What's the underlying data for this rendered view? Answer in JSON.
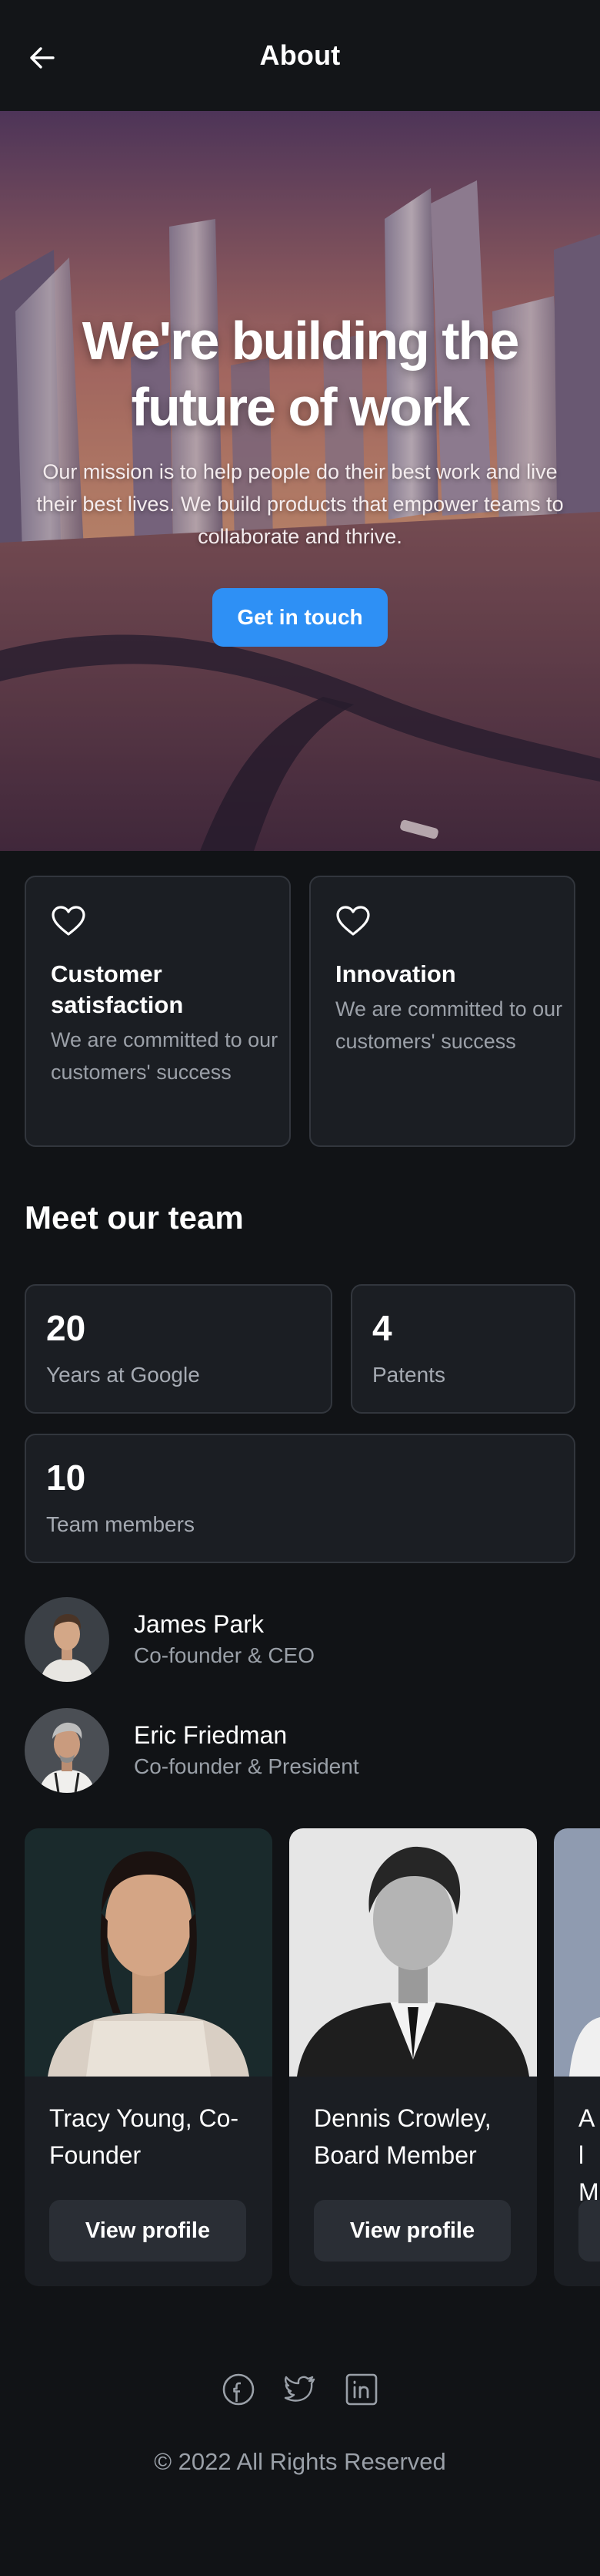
{
  "header": {
    "title": "About",
    "back_icon": "arrow-left-icon"
  },
  "hero": {
    "title": "We're building the future of work",
    "text": "Our mission is to help people do their best work and live their best lives. We build products that empower teams to collaborate and thrive.",
    "cta_label": "Get in touch",
    "accent": "#2e90f5"
  },
  "values": [
    {
      "icon": "heart-icon",
      "title": "Customer satisfaction",
      "desc": "We are committed to our customers' success"
    },
    {
      "icon": "heart-icon",
      "title": "Innovation",
      "desc": "We are committed to our customers' success"
    }
  ],
  "team_section": {
    "title": "Meet our team"
  },
  "stats": [
    {
      "value": "20",
      "label": "Years at Google"
    },
    {
      "value": "4",
      "label": "Patents"
    },
    {
      "value": "10",
      "label": "Team members"
    }
  ],
  "members": [
    {
      "name": "James Park",
      "role": "Co-founder & CEO"
    },
    {
      "name": "Eric Friedman",
      "role": "Co-founder & President"
    }
  ],
  "profiles": [
    {
      "name": "Tracy Young, Co-Founder",
      "button": "View profile"
    },
    {
      "name": "Dennis Crowley, Board Member",
      "button": "View profile"
    },
    {
      "name": "Al M",
      "button": ""
    }
  ],
  "footer": {
    "social": [
      "facebook-icon",
      "twitter-icon",
      "linkedin-icon"
    ],
    "copyright": "© 2022 All Rights Reserved"
  }
}
